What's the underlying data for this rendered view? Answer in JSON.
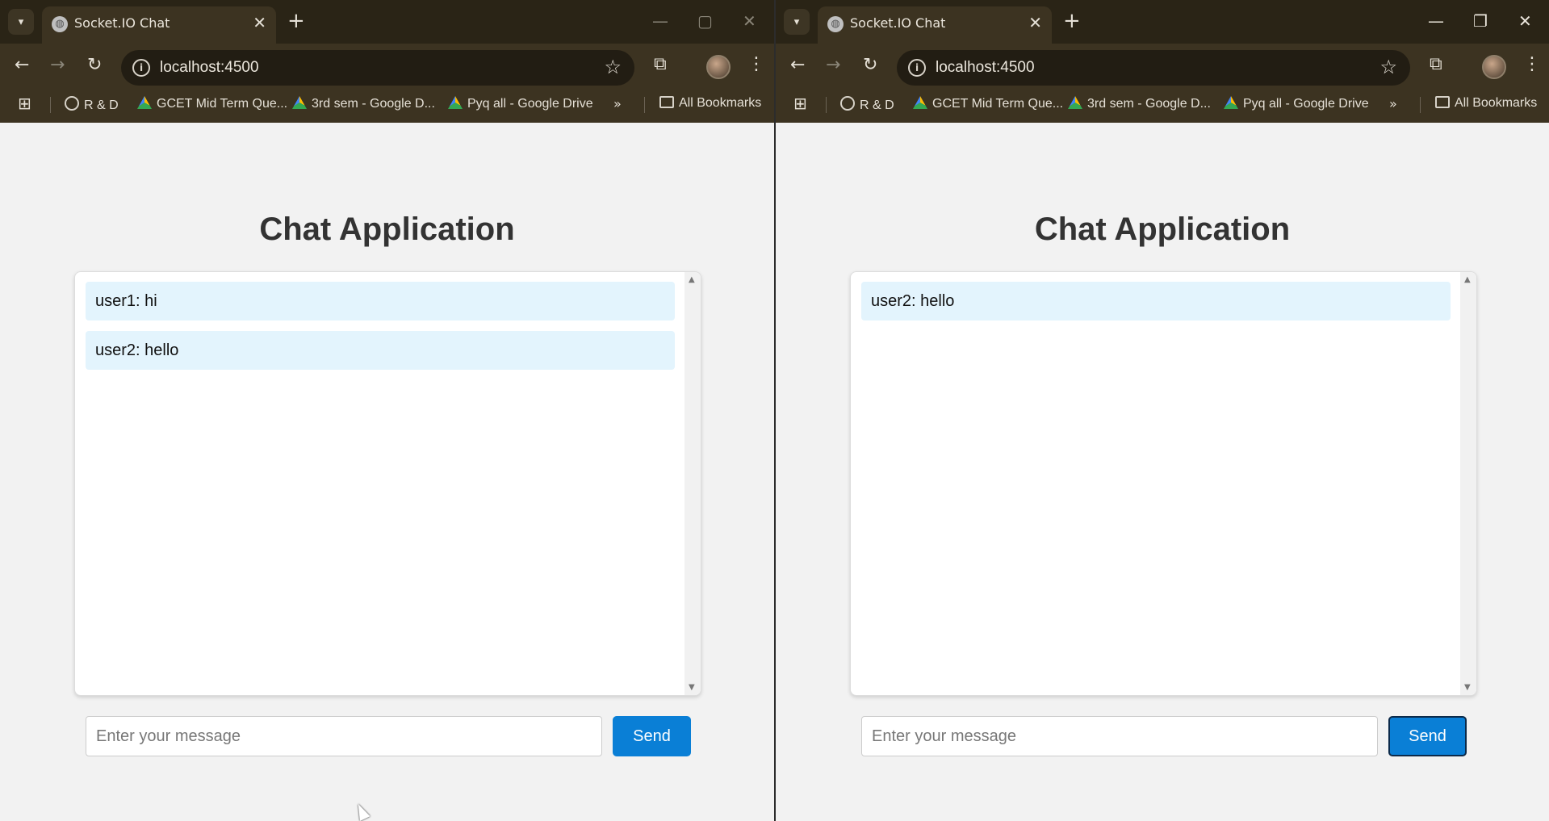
{
  "tab": {
    "title": "Socket.IO Chat"
  },
  "address": {
    "url": "localhost:4500"
  },
  "bookmarks": {
    "items": [
      {
        "label": "R & D",
        "icon": "folder-logo-icon"
      },
      {
        "label": "GCET Mid Term Que...",
        "icon": "google-drive-icon"
      },
      {
        "label": "3rd sem - Google D...",
        "icon": "google-drive-icon"
      },
      {
        "label": "Pyq all - Google Drive",
        "icon": "google-drive-icon"
      }
    ],
    "all_label": "All Bookmarks"
  },
  "windows": {
    "left": {
      "heading": "Chat Application",
      "messages": [
        "user1: hi",
        "user2: hello"
      ],
      "input_placeholder": "Enter your message",
      "send_label": "Send"
    },
    "right": {
      "heading": "Chat Application",
      "messages": [
        "user2: hello"
      ],
      "input_placeholder": "Enter your message",
      "send_label": "Send"
    }
  },
  "colors": {
    "send_button": "#0a7fd6",
    "message_bg": "#e3f4fd",
    "chrome_frame": "#3c3321"
  }
}
